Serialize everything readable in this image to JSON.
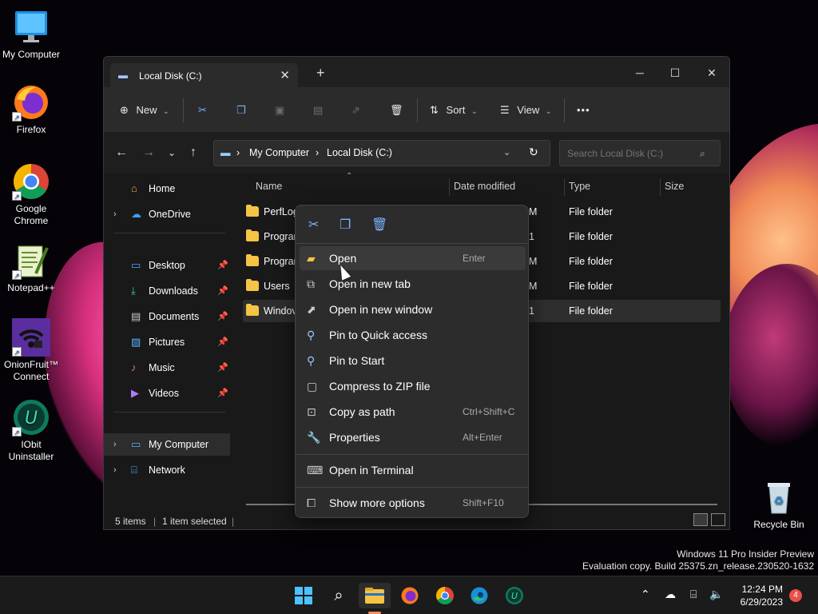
{
  "desktop": {
    "icons": [
      {
        "label": "My Computer",
        "icon": "monitor-icon"
      },
      {
        "label": "Firefox",
        "icon": "firefox-icon"
      },
      {
        "label": "Google Chrome",
        "icon": "chrome-icon"
      },
      {
        "label": "Notepad++",
        "icon": "notepadpp-icon"
      },
      {
        "label": "OnionFruit™ Connect",
        "icon": "onionfruit-icon"
      },
      {
        "label": "IObit Uninstaller",
        "icon": "iobit-icon"
      }
    ],
    "recycle_bin": "Recycle Bin"
  },
  "window": {
    "tab_title": "Local Disk (C:)",
    "toolbar": {
      "new_label": "New",
      "sort_label": "Sort",
      "view_label": "View",
      "more_label": "•••"
    },
    "address": {
      "crumbs": [
        "My Computer",
        "Local Disk (C:)"
      ],
      "separator": "›"
    },
    "search_placeholder": "Search Local Disk (C:)",
    "sidebar": {
      "home": "Home",
      "onedrive": "OneDrive",
      "quick": [
        "Desktop",
        "Downloads",
        "Documents",
        "Pictures",
        "Music",
        "Videos"
      ],
      "my_computer": "My Computer",
      "network": "Network"
    },
    "columns": {
      "name": "Name",
      "date": "Date modified",
      "type": "Type",
      "size": "Size"
    },
    "rows": [
      {
        "name": "PerfLog",
        "date": "M",
        "type": "File folder"
      },
      {
        "name": "Progran",
        "date": "1",
        "type": "File folder"
      },
      {
        "name": "Progran",
        "date": "M",
        "type": "File folder"
      },
      {
        "name": "Users",
        "date": "M",
        "type": "File folder"
      },
      {
        "name": "Windov",
        "date": "1",
        "type": "File folder"
      }
    ],
    "status": {
      "count": "5 items",
      "selected": "1 item selected"
    }
  },
  "context_menu": {
    "items": [
      {
        "label": "Open",
        "key": "Enter"
      },
      {
        "label": "Open in new tab",
        "key": ""
      },
      {
        "label": "Open in new window",
        "key": ""
      },
      {
        "label": "Pin to Quick access",
        "key": ""
      },
      {
        "label": "Pin to Start",
        "key": ""
      },
      {
        "label": "Compress to ZIP file",
        "key": ""
      },
      {
        "label": "Copy as path",
        "key": "Ctrl+Shift+C"
      },
      {
        "label": "Properties",
        "key": "Alt+Enter"
      }
    ],
    "terminal": {
      "label": "Open in Terminal"
    },
    "more": {
      "label": "Show more options",
      "key": "Shift+F10"
    }
  },
  "watermark": {
    "line1": "Windows 11 Pro Insider Preview",
    "line2": "Evaluation copy. Build 25375.zn_release.230520-1632"
  },
  "taskbar": {
    "time": "12:24 PM",
    "date": "6/29/2023",
    "notifications": "4"
  },
  "colors": {
    "accent": "#4cc2ff",
    "folder": "#f5c444",
    "badge": "#e8524a"
  }
}
